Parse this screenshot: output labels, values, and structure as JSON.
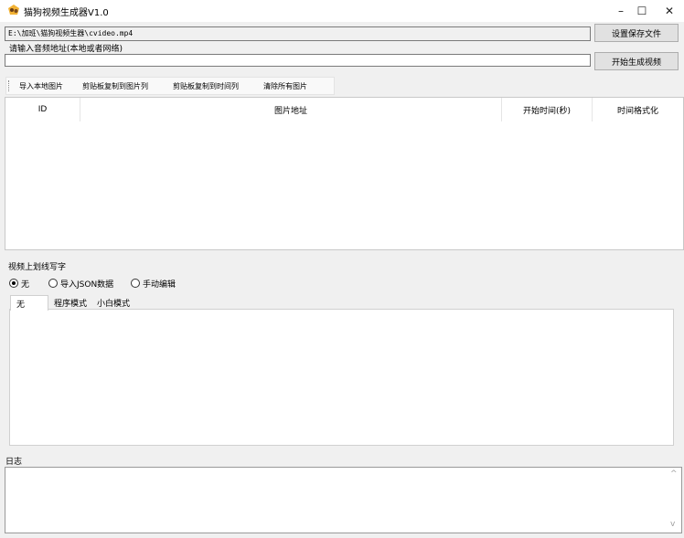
{
  "window": {
    "title": "猫狗视频生成器V1.0",
    "icon": "cat-dog-app-icon",
    "controls": {
      "minimize": "–",
      "maximize": "☐",
      "close": "✕"
    }
  },
  "video": {
    "path": "E:\\加班\\猫狗视频生器\\cvideo.mp4",
    "set_save_label": "设置保存文件"
  },
  "audio": {
    "label": "请输入音频地址(本地或者网络)",
    "value": "",
    "start_label": "开始生成视频"
  },
  "toolbar": {
    "items": [
      "导入本地图片",
      "剪贴板复制到图片列",
      "剪贴板复制到时间列",
      "清除所有图片"
    ]
  },
  "image_table": {
    "columns": [
      "ID",
      "图片地址",
      "开始时间(秒)",
      "时间格式化"
    ],
    "rows": []
  },
  "drawing": {
    "label": "视频上划线写字",
    "options": [
      {
        "label": "无",
        "selected": true
      },
      {
        "label": "导入JSON数据",
        "selected": false
      },
      {
        "label": "手动编辑",
        "selected": false
      }
    ],
    "tabs": [
      "无",
      "程序模式",
      "小白模式"
    ]
  },
  "log": {
    "label": "日志",
    "scroll_up": "^",
    "scroll_down": "v"
  }
}
